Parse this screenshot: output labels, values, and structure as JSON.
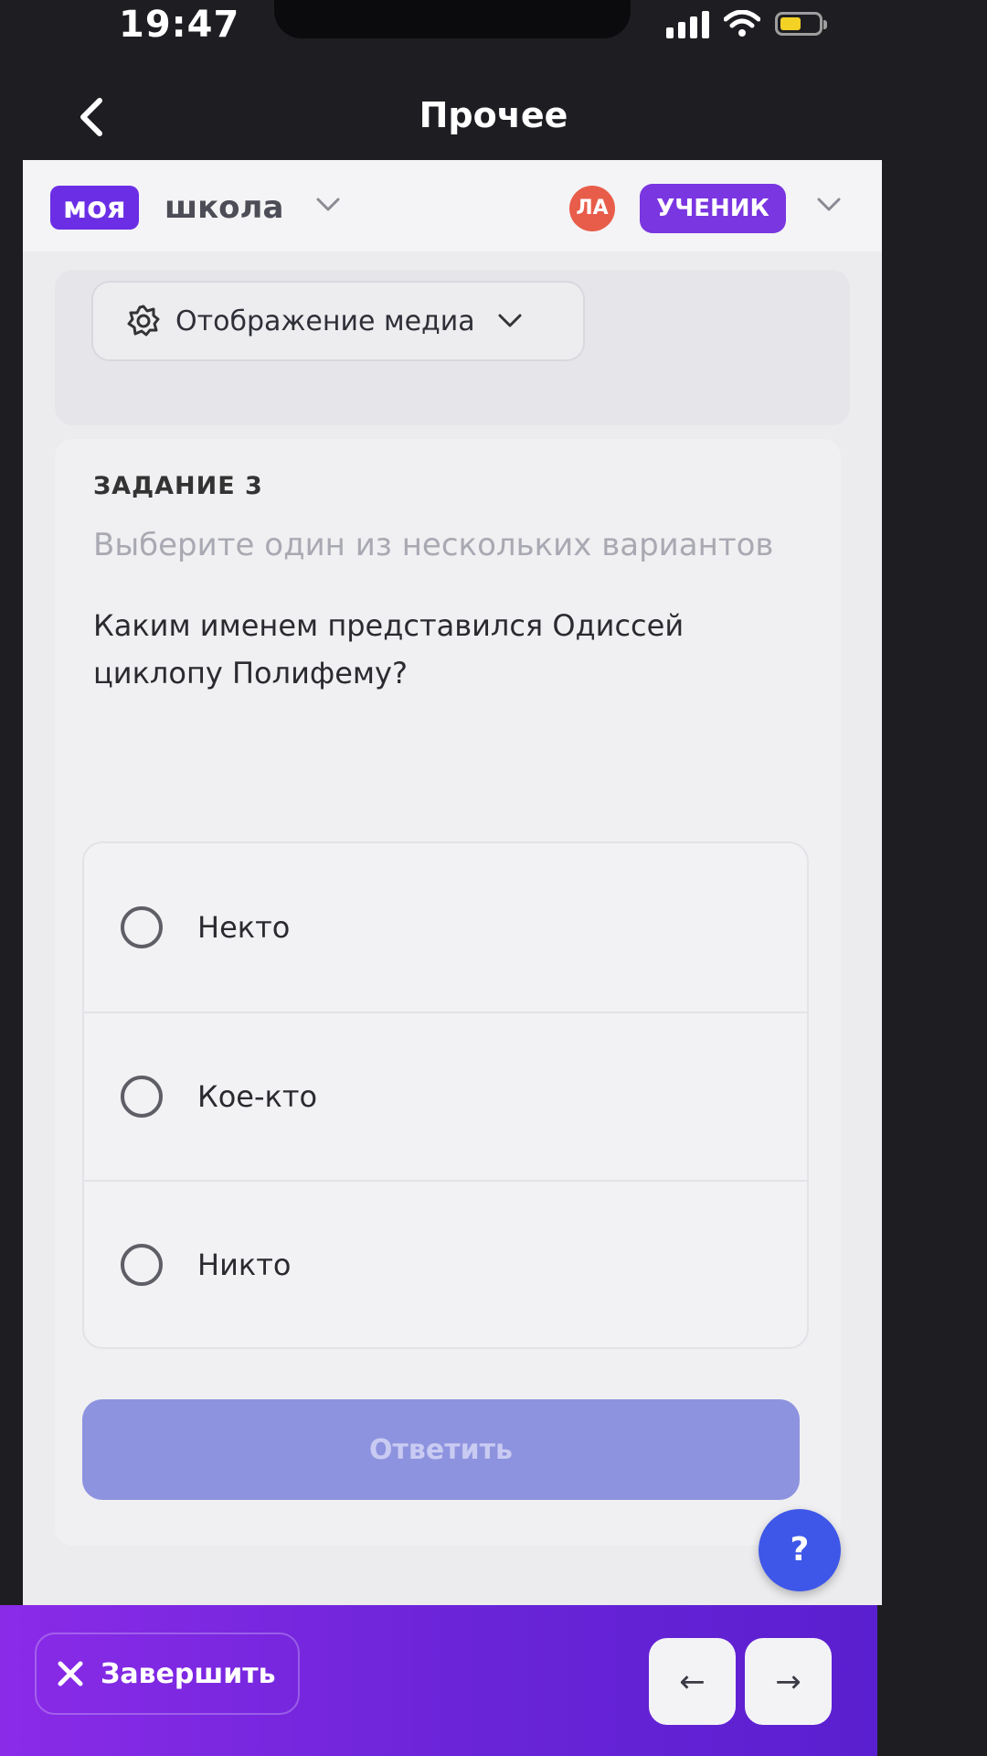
{
  "status_bar": {
    "time": "19:47"
  },
  "nav": {
    "title": "Прочее"
  },
  "header": {
    "logo_badge": "моя",
    "logo_text": "школа",
    "avatar_initials": "ЛА",
    "role": "УЧЕНИК"
  },
  "media": {
    "label": "Отображение медиа"
  },
  "task": {
    "number": "ЗАДАНИЕ 3",
    "hint": "Выберите один из нескольких вариантов",
    "question": "Каким именем  представился Одиссей циклопу Полифему?",
    "options": [
      {
        "label": "Некто"
      },
      {
        "label": "Кое-кто"
      },
      {
        "label": "Никто"
      }
    ],
    "answer_label": "Ответить"
  },
  "help": {
    "label": "?"
  },
  "footer": {
    "finish_label": "Завершить",
    "prev_symbol": "←",
    "next_symbol": "→"
  },
  "colors": {
    "brand_purple": "#6b2ee5",
    "avatar_red": "#e85d4a",
    "answer_disabled": "#8e93df",
    "help_blue": "#3e57e8",
    "battery_yellow": "#f4d125"
  }
}
